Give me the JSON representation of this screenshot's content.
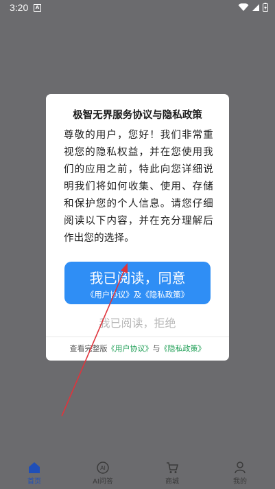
{
  "status": {
    "time": "3:20",
    "a_icon": "A"
  },
  "dialog": {
    "title": "极智无界服务协议与隐私政策",
    "body": "尊敬的用户，您好！我们非常重视您的隐私权益，并在您使用我们的应用之前，特此向您详细说明我们将如何收集、使用、存储和保护您的个人信息。请您仔细阅读以下内容，并在充分理解后作出您的选择。",
    "agree_label": "我已阅读，同意",
    "agree_sub_user": "《用户协议》",
    "agree_sub_and": "及",
    "agree_sub_privacy": "《隐私政策》",
    "decline_label": "我已阅读，拒绝",
    "footer_prefix": "查看完整版",
    "footer_user_link": "《用户协议》",
    "footer_and": "与",
    "footer_privacy_link": "《隐私政策》"
  },
  "tabs": [
    {
      "label": "首页",
      "icon": "home-icon"
    },
    {
      "label": "AI问答",
      "icon": "ai-icon"
    },
    {
      "label": "商城",
      "icon": "cart-icon"
    },
    {
      "label": "我的",
      "icon": "profile-icon"
    }
  ],
  "colors": {
    "primary": "#2f8ef5",
    "link": "#1f9f56",
    "active_tab": "#1f4fb8",
    "arrow": "#e0343c"
  }
}
